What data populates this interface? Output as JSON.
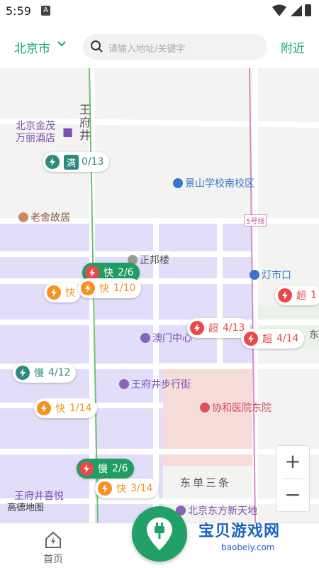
{
  "status": {
    "time": "5:59",
    "sim_icon": "A"
  },
  "header": {
    "city": "北京市",
    "search_placeholder": "请输入地址/关键字",
    "nearby": "附近"
  },
  "map": {
    "pois": {
      "wangfujing_road": "王府井",
      "hotel": "北京金茂\n万丽酒店",
      "school": "景山学校南校区",
      "laoshe": "老舍故居",
      "metro5": "5号线",
      "zhengbang": "正邦楼",
      "dengshikou": "灯市口",
      "aomen": "澳门中心",
      "pedestrian": "王府井步行街",
      "hospital": "协和医院东院",
      "dongdan": "东单三条",
      "dongfang": "北京东方新天地",
      "xiyue": "王府井喜悦",
      "east_edge": "东"
    },
    "stations": [
      {
        "type_label": "满",
        "count": "0/13",
        "style": "teal"
      },
      {
        "type_label": "快",
        "count": "2/6",
        "style": "green"
      },
      {
        "type_label": "快",
        "count": "1/10",
        "style": "orange"
      },
      {
        "type_label": "快",
        "count": "",
        "style": "orange"
      },
      {
        "type_label": "超",
        "count": "1",
        "style": "red"
      },
      {
        "type_label": "超",
        "count": "4/13",
        "style": "red"
      },
      {
        "type_label": "超",
        "count": "4/14",
        "style": "red"
      },
      {
        "type_label": "慢",
        "count": "4/12",
        "style": "teal"
      },
      {
        "type_label": "快",
        "count": "1/14",
        "style": "orange"
      },
      {
        "type_label": "慢",
        "count": "2/6",
        "style": "green"
      },
      {
        "type_label": "快",
        "count": "3/14",
        "style": "orange"
      }
    ],
    "zoom_in": "+",
    "zoom_out": "−",
    "provider_logo": "高德地图"
  },
  "bottom": {
    "home_label": "首页"
  },
  "watermark": {
    "title": "宝贝游戏网",
    "url": "baobeiy.com"
  },
  "colors": {
    "accent": "#1aa36b",
    "fast": "#f39321",
    "super": "#e84a4a",
    "slow": "#2e8a7e"
  }
}
